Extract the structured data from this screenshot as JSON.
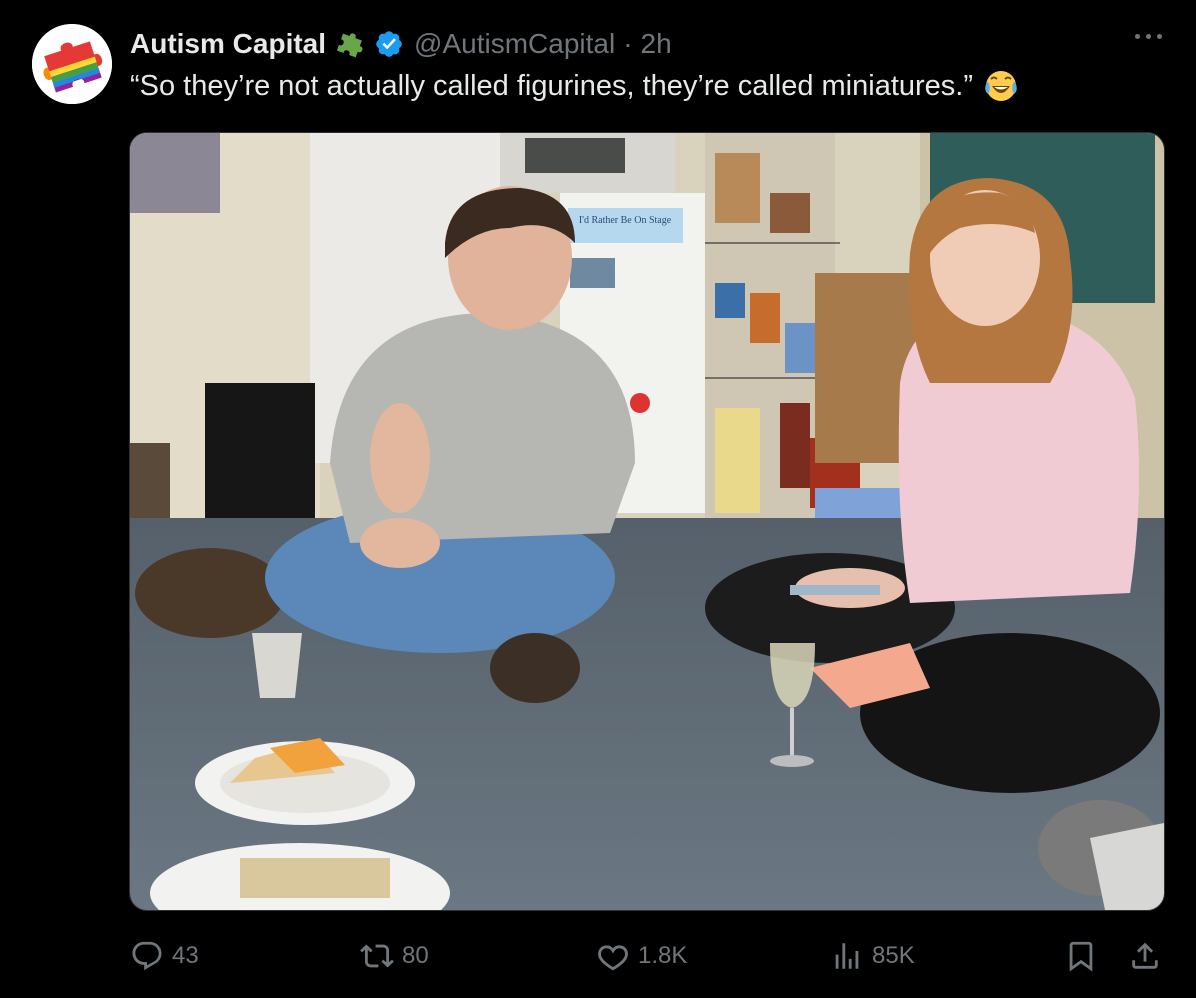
{
  "tweet": {
    "author_name": "Autism Capital",
    "handle": "@AutismCapital",
    "separator": "·",
    "time": "2h",
    "text": "“So they’re not actually called figurines, they’re called miniatures.”",
    "emoji": "face-with-tears-of-joy"
  },
  "media": {
    "poster_text": "I'd Rather Be On Stage"
  },
  "actions": {
    "replies": "43",
    "reposts": "80",
    "likes": "1.8K",
    "views": "85K"
  },
  "colors": {
    "background": "#000000",
    "primary_text": "#e7e9ea",
    "secondary_text": "#71767b",
    "verified_blue": "#1d9bf0",
    "puzzle_green": "#6ba54a"
  },
  "icons": [
    "more-icon",
    "reply-icon",
    "repost-icon",
    "like-icon",
    "views-icon",
    "bookmark-icon",
    "share-icon",
    "verified-icon",
    "puzzle-icon"
  ]
}
